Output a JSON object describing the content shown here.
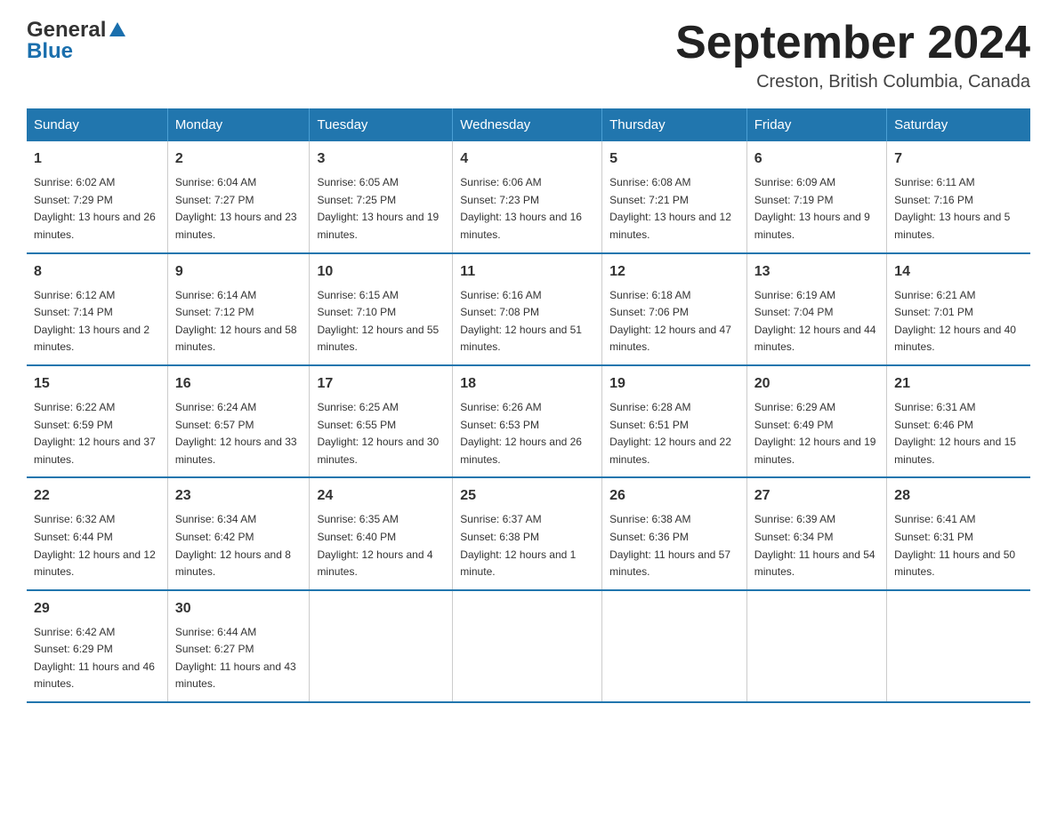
{
  "header": {
    "logo": {
      "general": "General",
      "blue": "Blue"
    },
    "title": "September 2024",
    "location": "Creston, British Columbia, Canada"
  },
  "days_of_week": [
    "Sunday",
    "Monday",
    "Tuesday",
    "Wednesday",
    "Thursday",
    "Friday",
    "Saturday"
  ],
  "weeks": [
    [
      {
        "day": "1",
        "sunrise": "6:02 AM",
        "sunset": "7:29 PM",
        "daylight": "13 hours and 26 minutes."
      },
      {
        "day": "2",
        "sunrise": "6:04 AM",
        "sunset": "7:27 PM",
        "daylight": "13 hours and 23 minutes."
      },
      {
        "day": "3",
        "sunrise": "6:05 AM",
        "sunset": "7:25 PM",
        "daylight": "13 hours and 19 minutes."
      },
      {
        "day": "4",
        "sunrise": "6:06 AM",
        "sunset": "7:23 PM",
        "daylight": "13 hours and 16 minutes."
      },
      {
        "day": "5",
        "sunrise": "6:08 AM",
        "sunset": "7:21 PM",
        "daylight": "13 hours and 12 minutes."
      },
      {
        "day": "6",
        "sunrise": "6:09 AM",
        "sunset": "7:19 PM",
        "daylight": "13 hours and 9 minutes."
      },
      {
        "day": "7",
        "sunrise": "6:11 AM",
        "sunset": "7:16 PM",
        "daylight": "13 hours and 5 minutes."
      }
    ],
    [
      {
        "day": "8",
        "sunrise": "6:12 AM",
        "sunset": "7:14 PM",
        "daylight": "13 hours and 2 minutes."
      },
      {
        "day": "9",
        "sunrise": "6:14 AM",
        "sunset": "7:12 PM",
        "daylight": "12 hours and 58 minutes."
      },
      {
        "day": "10",
        "sunrise": "6:15 AM",
        "sunset": "7:10 PM",
        "daylight": "12 hours and 55 minutes."
      },
      {
        "day": "11",
        "sunrise": "6:16 AM",
        "sunset": "7:08 PM",
        "daylight": "12 hours and 51 minutes."
      },
      {
        "day": "12",
        "sunrise": "6:18 AM",
        "sunset": "7:06 PM",
        "daylight": "12 hours and 47 minutes."
      },
      {
        "day": "13",
        "sunrise": "6:19 AM",
        "sunset": "7:04 PM",
        "daylight": "12 hours and 44 minutes."
      },
      {
        "day": "14",
        "sunrise": "6:21 AM",
        "sunset": "7:01 PM",
        "daylight": "12 hours and 40 minutes."
      }
    ],
    [
      {
        "day": "15",
        "sunrise": "6:22 AM",
        "sunset": "6:59 PM",
        "daylight": "12 hours and 37 minutes."
      },
      {
        "day": "16",
        "sunrise": "6:24 AM",
        "sunset": "6:57 PM",
        "daylight": "12 hours and 33 minutes."
      },
      {
        "day": "17",
        "sunrise": "6:25 AM",
        "sunset": "6:55 PM",
        "daylight": "12 hours and 30 minutes."
      },
      {
        "day": "18",
        "sunrise": "6:26 AM",
        "sunset": "6:53 PM",
        "daylight": "12 hours and 26 minutes."
      },
      {
        "day": "19",
        "sunrise": "6:28 AM",
        "sunset": "6:51 PM",
        "daylight": "12 hours and 22 minutes."
      },
      {
        "day": "20",
        "sunrise": "6:29 AM",
        "sunset": "6:49 PM",
        "daylight": "12 hours and 19 minutes."
      },
      {
        "day": "21",
        "sunrise": "6:31 AM",
        "sunset": "6:46 PM",
        "daylight": "12 hours and 15 minutes."
      }
    ],
    [
      {
        "day": "22",
        "sunrise": "6:32 AM",
        "sunset": "6:44 PM",
        "daylight": "12 hours and 12 minutes."
      },
      {
        "day": "23",
        "sunrise": "6:34 AM",
        "sunset": "6:42 PM",
        "daylight": "12 hours and 8 minutes."
      },
      {
        "day": "24",
        "sunrise": "6:35 AM",
        "sunset": "6:40 PM",
        "daylight": "12 hours and 4 minutes."
      },
      {
        "day": "25",
        "sunrise": "6:37 AM",
        "sunset": "6:38 PM",
        "daylight": "12 hours and 1 minute."
      },
      {
        "day": "26",
        "sunrise": "6:38 AM",
        "sunset": "6:36 PM",
        "daylight": "11 hours and 57 minutes."
      },
      {
        "day": "27",
        "sunrise": "6:39 AM",
        "sunset": "6:34 PM",
        "daylight": "11 hours and 54 minutes."
      },
      {
        "day": "28",
        "sunrise": "6:41 AM",
        "sunset": "6:31 PM",
        "daylight": "11 hours and 50 minutes."
      }
    ],
    [
      {
        "day": "29",
        "sunrise": "6:42 AM",
        "sunset": "6:29 PM",
        "daylight": "11 hours and 46 minutes."
      },
      {
        "day": "30",
        "sunrise": "6:44 AM",
        "sunset": "6:27 PM",
        "daylight": "11 hours and 43 minutes."
      },
      null,
      null,
      null,
      null,
      null
    ]
  ]
}
